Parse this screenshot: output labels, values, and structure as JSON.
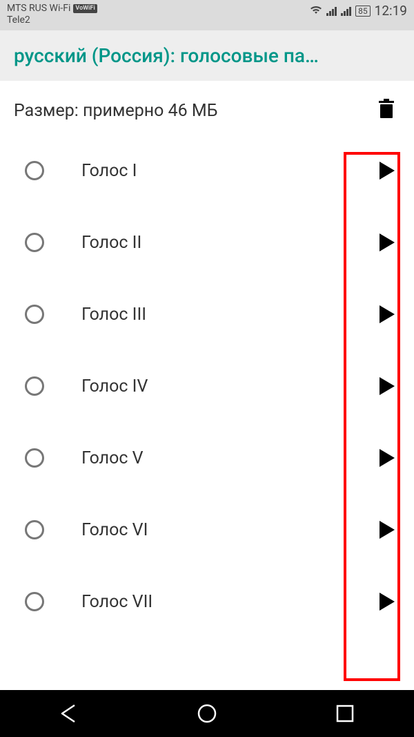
{
  "status": {
    "carrier_wifi": "MTS RUS Wi-Fi",
    "vowifi": "VoWiFi",
    "carrier2": "Tele2",
    "battery": "85",
    "time": "12:19"
  },
  "header": {
    "title": "русский (Россия): голосовые па…"
  },
  "size_row": {
    "text": "Размер: примерно 46 МБ"
  },
  "voices": [
    {
      "label": "Голос I"
    },
    {
      "label": "Голос II"
    },
    {
      "label": "Голос III"
    },
    {
      "label": "Голос IV"
    },
    {
      "label": "Голос V"
    },
    {
      "label": "Голос VI"
    },
    {
      "label": "Голос VII"
    }
  ]
}
